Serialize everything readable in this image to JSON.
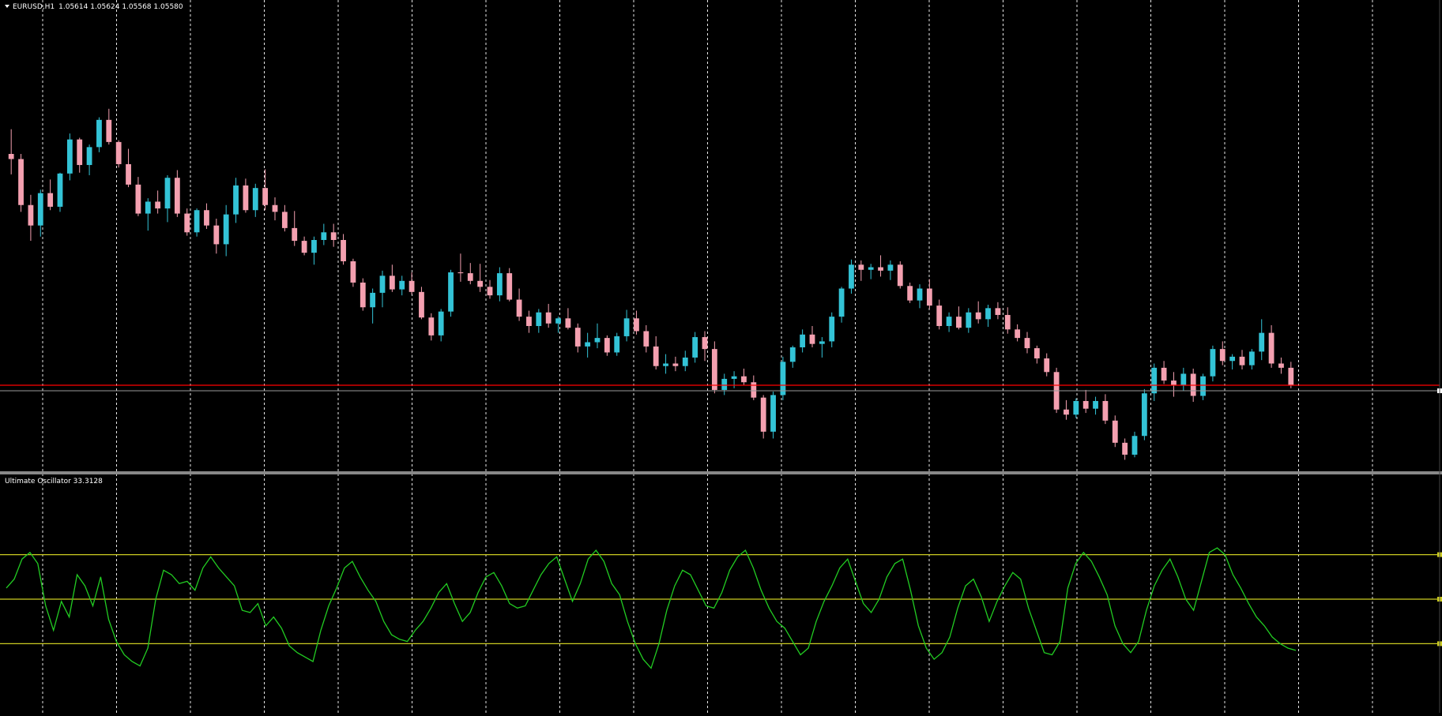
{
  "chart_data": [
    {
      "type": "candlestick",
      "symbol": "EURUSD,H1",
      "ohlc_readout": {
        "open": "1.05614",
        "high": "1.05624",
        "low": "1.05568",
        "close": "1.05580"
      },
      "colors": {
        "bull": "#33c3d6",
        "bear": "#f4a0b0",
        "grid": "#ffffff",
        "background": "#000000",
        "current_price_line": "#ff0000"
      },
      "grid": true,
      "current_price": 1.0558,
      "ylim": [
        1.047,
        1.1
      ],
      "ohlc": [
        [
          1.0836,
          1.0865,
          1.0812,
          1.083
        ],
        [
          1.083,
          1.0836,
          1.0768,
          1.0776
        ],
        [
          1.0776,
          1.0788,
          1.0734,
          1.0752
        ],
        [
          1.0752,
          1.0794,
          1.0739,
          1.079
        ],
        [
          1.079,
          1.0806,
          1.077,
          1.0774
        ],
        [
          1.0774,
          1.0814,
          1.0768,
          1.0813
        ],
        [
          1.0813,
          1.086,
          1.0805,
          1.0853
        ],
        [
          1.0853,
          1.0855,
          1.0814,
          1.0823
        ],
        [
          1.0823,
          1.0847,
          1.0811,
          1.0844
        ],
        [
          1.0844,
          1.0879,
          1.0838,
          1.0876
        ],
        [
          1.0876,
          1.0889,
          1.0847,
          1.085
        ],
        [
          1.085,
          1.0852,
          1.082,
          1.0824
        ],
        [
          1.0824,
          1.0842,
          1.0797,
          1.08
        ],
        [
          1.08,
          1.0809,
          1.0763,
          1.0766
        ],
        [
          1.0766,
          1.0784,
          1.0746,
          1.078
        ],
        [
          1.078,
          1.0793,
          1.0766,
          1.0772
        ],
        [
          1.0772,
          1.0811,
          1.0756,
          1.0808
        ],
        [
          1.0808,
          1.0817,
          1.0762,
          1.0766
        ],
        [
          1.0766,
          1.0772,
          1.074,
          1.0744
        ],
        [
          1.0744,
          1.0772,
          1.0739,
          1.077
        ],
        [
          1.077,
          1.0778,
          1.0748,
          1.0752
        ],
        [
          1.0752,
          1.076,
          1.0719,
          1.073
        ],
        [
          1.073,
          1.0776,
          1.0716,
          1.0765
        ],
        [
          1.0765,
          1.0808,
          1.0755,
          1.0799
        ],
        [
          1.0799,
          1.0807,
          1.0767,
          1.077
        ],
        [
          1.077,
          1.0801,
          1.0762,
          1.0796
        ],
        [
          1.0796,
          1.0818,
          1.077,
          1.0776
        ],
        [
          1.0776,
          1.0785,
          1.0758,
          1.0768
        ],
        [
          1.0768,
          1.0776,
          1.0745,
          1.0749
        ],
        [
          1.0749,
          1.0769,
          1.0728,
          1.0734
        ],
        [
          1.0734,
          1.0739,
          1.0717,
          1.072
        ],
        [
          1.072,
          1.0739,
          1.0706,
          1.0735
        ],
        [
          1.0735,
          1.0754,
          1.0729,
          1.0744
        ],
        [
          1.0744,
          1.0754,
          1.0727,
          1.0735
        ],
        [
          1.0735,
          1.0742,
          1.0706,
          1.071
        ],
        [
          1.071,
          1.0713,
          1.068,
          1.0685
        ],
        [
          1.0685,
          1.069,
          1.0652,
          1.0656
        ],
        [
          1.0656,
          1.0678,
          1.0637,
          1.0673
        ],
        [
          1.0673,
          1.0699,
          1.0656,
          1.0693
        ],
        [
          1.0693,
          1.0706,
          1.0674,
          1.0677
        ],
        [
          1.0677,
          1.0693,
          1.067,
          1.0687
        ],
        [
          1.0687,
          1.0697,
          1.0671,
          1.0674
        ],
        [
          1.0674,
          1.068,
          1.0642,
          1.0644
        ],
        [
          1.0644,
          1.0649,
          1.0617,
          1.0623
        ],
        [
          1.0623,
          1.0654,
          1.0616,
          1.0651
        ],
        [
          1.0651,
          1.07,
          1.0645,
          1.0697
        ],
        [
          1.0697,
          1.0719,
          1.0686,
          1.0696
        ],
        [
          1.0696,
          1.0708,
          1.0683,
          1.0687
        ],
        [
          1.0687,
          1.0707,
          1.0674,
          1.068
        ],
        [
          1.068,
          1.0688,
          1.0666,
          1.067
        ],
        [
          1.067,
          1.0703,
          1.0663,
          1.0696
        ],
        [
          1.0696,
          1.0702,
          1.0663,
          1.0665
        ],
        [
          1.0665,
          1.0678,
          1.064,
          1.0645
        ],
        [
          1.0645,
          1.0652,
          1.0626,
          1.0634
        ],
        [
          1.0634,
          1.0654,
          1.0626,
          1.065
        ],
        [
          1.065,
          1.066,
          1.0632,
          1.0637
        ],
        [
          1.0637,
          1.0645,
          1.0626,
          1.0643
        ],
        [
          1.0643,
          1.0655,
          1.063,
          1.0632
        ],
        [
          1.0632,
          1.0637,
          1.0603,
          1.061
        ],
        [
          1.061,
          1.0626,
          1.0597,
          1.0615
        ],
        [
          1.0615,
          1.0637,
          1.0608,
          1.062
        ],
        [
          1.062,
          1.0623,
          1.0599,
          1.0603
        ],
        [
          1.0603,
          1.0626,
          1.0599,
          1.0622
        ],
        [
          1.0622,
          1.0653,
          1.0616,
          1.0643
        ],
        [
          1.0643,
          1.0652,
          1.0624,
          1.0628
        ],
        [
          1.0628,
          1.0635,
          1.0603,
          1.061
        ],
        [
          1.061,
          1.0622,
          1.0583,
          1.0587
        ],
        [
          1.0587,
          1.0601,
          1.0578,
          1.059
        ],
        [
          1.059,
          1.0598,
          1.0581,
          1.0587
        ],
        [
          1.0587,
          1.0605,
          1.0581,
          1.0597
        ],
        [
          1.0597,
          1.0627,
          1.0591,
          1.0621
        ],
        [
          1.0621,
          1.0628,
          1.0593,
          1.0607
        ],
        [
          1.0607,
          1.0616,
          1.0555,
          1.0559
        ],
        [
          1.0559,
          1.0578,
          1.0553,
          1.0572
        ],
        [
          1.0572,
          1.0581,
          1.0561,
          1.0575
        ],
        [
          1.0575,
          1.0584,
          1.0565,
          1.0568
        ],
        [
          1.0568,
          1.0576,
          1.0547,
          1.055
        ],
        [
          1.055,
          1.0553,
          1.0502,
          1.051
        ],
        [
          1.051,
          1.0557,
          1.0502,
          1.0553
        ],
        [
          1.0553,
          1.0598,
          1.0547,
          1.0592
        ],
        [
          1.0592,
          1.0611,
          1.0585,
          1.0609
        ],
        [
          1.0609,
          1.063,
          1.0603,
          1.0624
        ],
        [
          1.0624,
          1.0634,
          1.0609,
          1.0613
        ],
        [
          1.0613,
          1.0621,
          1.0597,
          1.0616
        ],
        [
          1.0616,
          1.065,
          1.0609,
          1.0645
        ],
        [
          1.0645,
          1.068,
          1.0638,
          1.0678
        ],
        [
          1.0678,
          1.0712,
          1.0672,
          1.0706
        ],
        [
          1.0706,
          1.0711,
          1.0687,
          1.07
        ],
        [
          1.07,
          1.0707,
          1.0689,
          1.0703
        ],
        [
          1.0703,
          1.0717,
          1.0692,
          1.0699
        ],
        [
          1.0699,
          1.0711,
          1.0688,
          1.0706
        ],
        [
          1.0706,
          1.071,
          1.0678,
          1.0681
        ],
        [
          1.0681,
          1.0685,
          1.0661,
          1.0664
        ],
        [
          1.0664,
          1.0683,
          1.0655,
          1.0678
        ],
        [
          1.0678,
          1.0689,
          1.0654,
          1.0658
        ],
        [
          1.0658,
          1.0665,
          1.063,
          1.0634
        ],
        [
          1.0634,
          1.065,
          1.0627,
          1.0645
        ],
        [
          1.0645,
          1.0657,
          1.063,
          1.0632
        ],
        [
          1.0632,
          1.0655,
          1.0626,
          1.065
        ],
        [
          1.065,
          1.0663,
          1.0637,
          1.0642
        ],
        [
          1.0642,
          1.0659,
          1.0633,
          1.0655
        ],
        [
          1.0655,
          1.0662,
          1.0642,
          1.0647
        ],
        [
          1.0647,
          1.0656,
          1.0625,
          1.063
        ],
        [
          1.063,
          1.0636,
          1.0616,
          1.062
        ],
        [
          1.062,
          1.0627,
          1.0602,
          1.0608
        ],
        [
          1.0608,
          1.0611,
          1.059,
          1.0596
        ],
        [
          1.0596,
          1.0602,
          1.0575,
          1.058
        ],
        [
          1.058,
          1.0585,
          1.0532,
          1.0536
        ],
        [
          1.0536,
          1.0547,
          1.0524,
          1.053
        ],
        [
          1.053,
          1.0549,
          1.0526,
          1.0546
        ],
        [
          1.0546,
          1.0559,
          1.0532,
          1.0537
        ],
        [
          1.0537,
          1.0551,
          1.053,
          1.0546
        ],
        [
          1.0546,
          1.0554,
          1.0519,
          1.0523
        ],
        [
          1.0523,
          1.0529,
          1.0492,
          1.0497
        ],
        [
          1.0497,
          1.0502,
          1.0477,
          1.0483
        ],
        [
          1.0483,
          1.051,
          1.048,
          1.0505
        ],
        [
          1.0505,
          1.056,
          1.05,
          1.0555
        ],
        [
          1.0555,
          1.059,
          1.0546,
          1.0585
        ],
        [
          1.0585,
          1.0593,
          1.0566,
          1.057
        ],
        [
          1.057,
          1.058,
          1.0551,
          1.0564
        ],
        [
          1.0564,
          1.0585,
          1.0558,
          1.0578
        ],
        [
          1.0578,
          1.0584,
          1.0545,
          1.0552
        ],
        [
          1.0552,
          1.0578,
          1.0547,
          1.0575
        ],
        [
          1.0575,
          1.0611,
          1.0569,
          1.0607
        ],
        [
          1.0607,
          1.0616,
          1.0588,
          1.0593
        ],
        [
          1.0593,
          1.0601,
          1.0583,
          1.0598
        ],
        [
          1.0598,
          1.0606,
          1.0583,
          1.0588
        ],
        [
          1.0588,
          1.0607,
          1.0583,
          1.0604
        ],
        [
          1.0604,
          1.0642,
          1.0594,
          1.0626
        ],
        [
          1.0626,
          1.0635,
          1.0585,
          1.059
        ],
        [
          1.059,
          1.0597,
          1.0578,
          1.0585
        ],
        [
          1.0585,
          1.0592,
          1.0561,
          1.0564
        ]
      ]
    },
    {
      "type": "line",
      "title": "Ultimate Oscillator 33.3128",
      "ylim": [
        0,
        100
      ],
      "levels": [
        30,
        50,
        70
      ],
      "colors": {
        "line": "#22cc22",
        "levels": "#cccc22"
      },
      "values": [
        55,
        59,
        68,
        71,
        66,
        47,
        36,
        49,
        42,
        61,
        56,
        47,
        60,
        41,
        31,
        25,
        22,
        20,
        28,
        50,
        63,
        61,
        57,
        58,
        54,
        64,
        69,
        64,
        60,
        56,
        45,
        44,
        48,
        38,
        42,
        37,
        29,
        26,
        24,
        22,
        36,
        47,
        55,
        64,
        67,
        60,
        54,
        49,
        40,
        34,
        32,
        31,
        36,
        40,
        46,
        53,
        57,
        48,
        40,
        44,
        53,
        60,
        62,
        56,
        48,
        46,
        47,
        54,
        61,
        66,
        69,
        59,
        49,
        57,
        68,
        72,
        67,
        57,
        52,
        40,
        30,
        23,
        19,
        30,
        45,
        56,
        63,
        61,
        54,
        47,
        46,
        53,
        63,
        69,
        72,
        64,
        54,
        46,
        40,
        37,
        31,
        25,
        28,
        40,
        49,
        56,
        64,
        68,
        58,
        48,
        44,
        50,
        60,
        66,
        68,
        54,
        38,
        28,
        23,
        26,
        33,
        46,
        56,
        59,
        51,
        40,
        49,
        56,
        62,
        59,
        46,
        36,
        26,
        25,
        31,
        55,
        66,
        71,
        67,
        60,
        52,
        38,
        30,
        26,
        31,
        45,
        56,
        63,
        68,
        60,
        50,
        45,
        58,
        71,
        73,
        70,
        61,
        55,
        48,
        42,
        38,
        33,
        30,
        28,
        27
      ]
    }
  ]
}
